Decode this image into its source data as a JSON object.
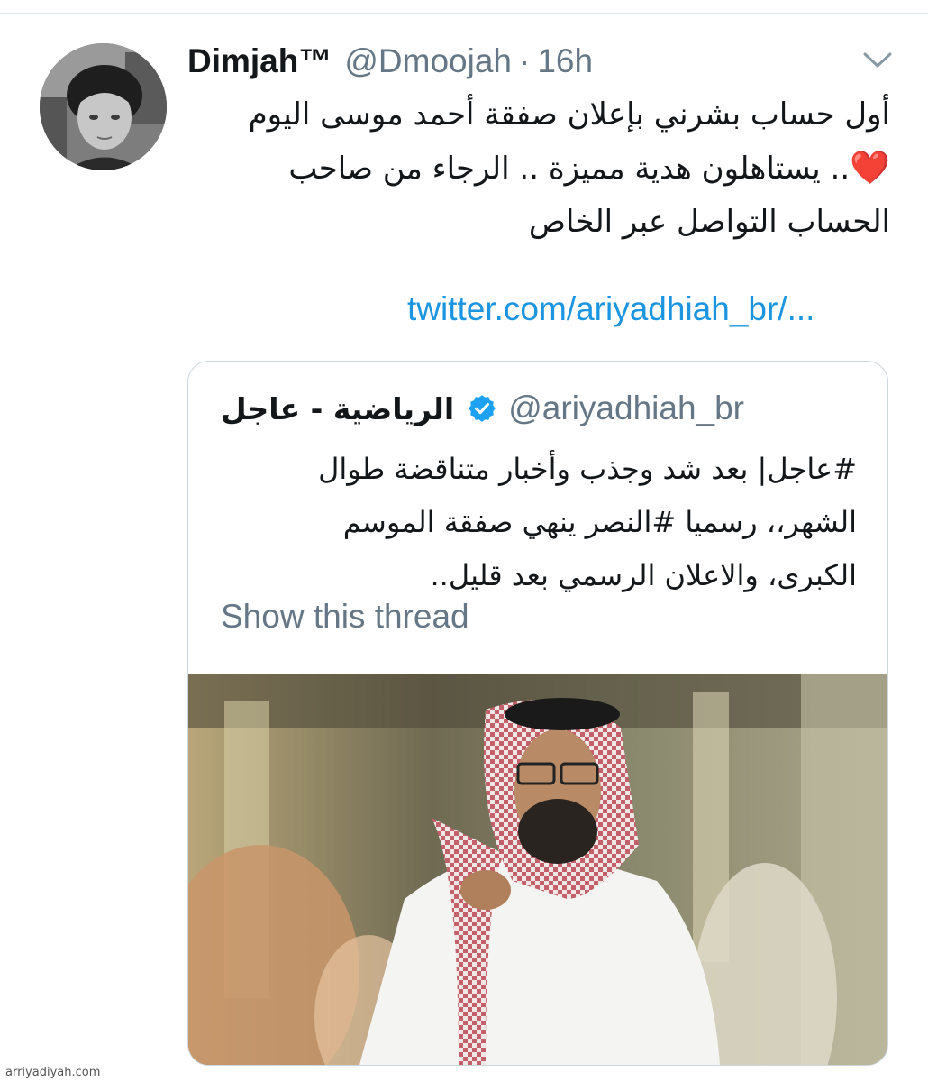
{
  "tweet": {
    "author_name": "Dimjah™",
    "author_handle": "@Dmoojah",
    "separator": "·",
    "time": "16h",
    "text_lines": [
      "أول حساب بشرني بإعلان صفقة أحمد موسى اليوم",
      ".. يستاهلون هدية مميزة .. الرجاء من صاحب",
      "الحساب التواصل عبر الخاص"
    ],
    "emoji": "❤️",
    "link": "twitter.com/ariyadhiah_br/..."
  },
  "quoted": {
    "author_name": "الرياضية - عاجل",
    "author_handle": "@ariyadhiah_br",
    "verified": true,
    "text_lines": [
      "#عاجل| بعد شد وجذب وأخبار متناقضة طوال",
      "الشهر،، رسميا #النصر ينهي صفقة الموسم",
      "الكبرى، والاعلان الرسمي بعد قليل.."
    ],
    "show_thread": "Show this thread"
  },
  "watermark": "arriyadiyah.com",
  "colors": {
    "link": "#1b95e0",
    "secondary_text": "#657786",
    "verified_badge": "#1da1f2",
    "heart": "#e0162b"
  }
}
